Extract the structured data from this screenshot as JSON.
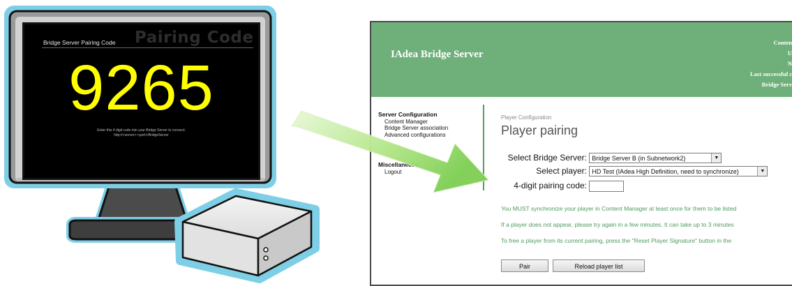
{
  "monitor": {
    "screen_title_large": "Pairing Code",
    "screen_title_small": "Bridge Server Pairing Code",
    "pairing_code": "9265",
    "instruction_line1": "Enter this 4 digit code into your Bridge Server to connect:",
    "instruction_line2": "http://<server>:<port>/BridgeServer"
  },
  "window": {
    "app_title": "IAdea Bridge Server",
    "header_info": [
      "Conten",
      "U",
      "N",
      "Last successful c",
      "Bridge Serv"
    ]
  },
  "sidebar": {
    "sections": [
      {
        "title": "Server Configuration",
        "items": [
          "Content Manager",
          "Bridge Server association",
          "Advanced configurations"
        ]
      },
      {
        "title": "Miscellaneous",
        "items": [
          "Logout"
        ]
      }
    ]
  },
  "main": {
    "breadcrumb": "Player Configuration",
    "title": "Player pairing",
    "bridge_server_label": "Select Bridge Server:",
    "bridge_server_value": "Bridge Server B (in Subnetwork2)",
    "player_label": "Select player:",
    "player_value": "HD Test (IAdea High Definition, need to synchronize)",
    "code_label": "4-digit pairing code:",
    "code_value": "",
    "messages": [
      "You MUST synchronize your player in Content Manager at least once for them to be listed",
      "If a player does not appear, please try again in a few minutes. It can take up to 3 minutes",
      "To free a player from its current pairing, press the \"Reset Player Signature\" button in the"
    ],
    "pair_button": "Pair",
    "reload_button": "Reload player list"
  },
  "colors": {
    "header_green": "#6fb07a",
    "message_green": "#4f9a5c",
    "pairing_code": "#ffff00",
    "monitor_outline": "#7ecfe6",
    "arrow_green": "#9ddb6f"
  },
  "icons": [
    "monitor-illustration",
    "player-box-illustration",
    "arrow-icon",
    "dropdown-arrow-icon"
  ]
}
